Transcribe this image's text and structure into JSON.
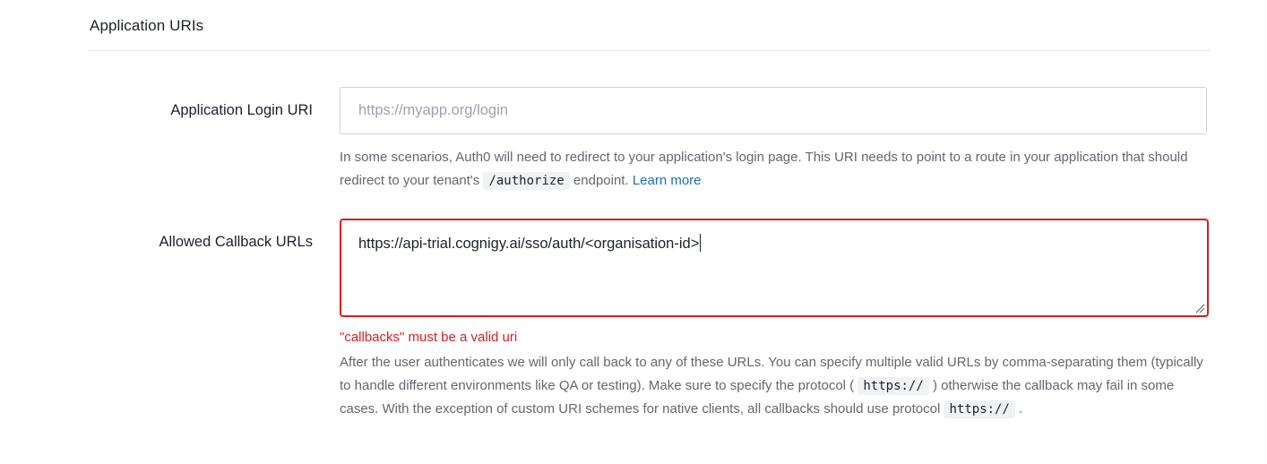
{
  "section": {
    "title": "Application URIs"
  },
  "login_uri": {
    "label": "Application Login URI",
    "placeholder": "https://myapp.org/login",
    "help_before": "In some scenarios, Auth0 will need to redirect to your application's login page. This URI needs to point to a route in your application that should redirect to your tenant's ",
    "help_code": "/authorize",
    "help_after": " endpoint. ",
    "learn_more": "Learn more"
  },
  "callback_urls": {
    "label": "Allowed Callback URLs",
    "value": "https://api-trial.cognigy.ai/sso/auth/<organisation-id>",
    "error": "\"callbacks\" must be a valid uri",
    "help_part1": "After the user authenticates we will only call back to any of these URLs. You can specify multiple valid URLs by comma-separating them (typically to handle different environments like QA or testing). Make sure to specify the protocol ( ",
    "help_code1": "https://",
    "help_part2": " ) otherwise the callback may fail in some cases. With the exception of custom URI schemes for native clients, all callbacks should use protocol ",
    "help_code2": "https://",
    "help_part3": " ."
  },
  "colors": {
    "error": "#e01b1b",
    "link": "#1d6fb5",
    "help_text": "#65676e"
  }
}
